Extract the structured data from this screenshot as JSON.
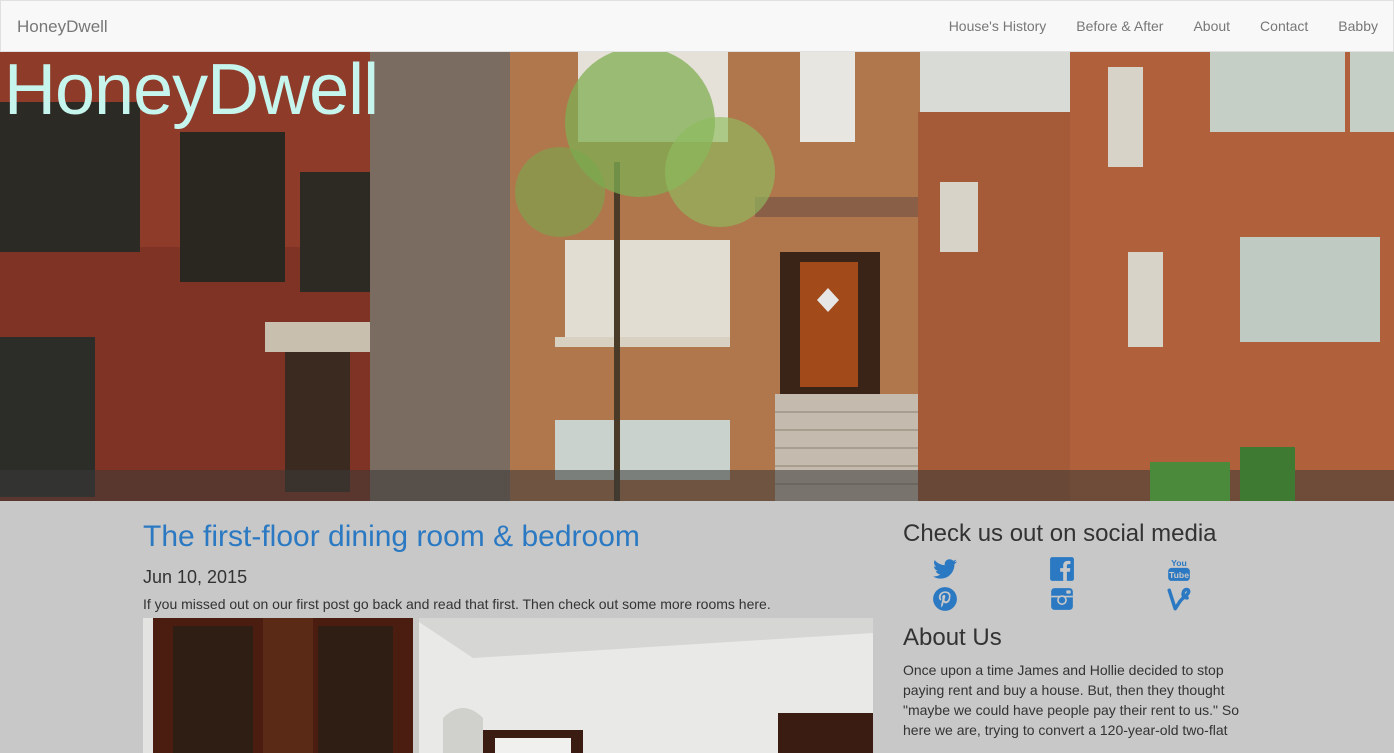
{
  "navbar": {
    "brand": "HoneyDwell",
    "links": [
      "House's History",
      "Before & After",
      "About",
      "Contact",
      "Babby"
    ]
  },
  "hero": {
    "title": "HoneyDwell"
  },
  "post": {
    "title": "The first-floor dining room & bedroom",
    "date": "Jun 10, 2015",
    "intro": "If you missed out on our first post go back and read that first. Then check out some more rooms here."
  },
  "sidebar": {
    "social_heading": "Check us out on social media",
    "social_icons": [
      "twitter-icon",
      "facebook-icon",
      "youtube-icon",
      "pinterest-icon",
      "instagram-icon",
      "vine-icon"
    ],
    "about_heading": "About Us",
    "about_text": "Once upon a time James and Hollie decided to stop paying rent and buy a house. But, then they thought \"maybe we could have people pay their rent to us.\" So here we are, trying to convert a 120-year-old two-flat"
  },
  "colors": {
    "accent": "#2a79c2",
    "hero_title": "#c6f5ee",
    "content_bg": "#c8c8c8",
    "navbar_bg": "#f8f8f8"
  }
}
